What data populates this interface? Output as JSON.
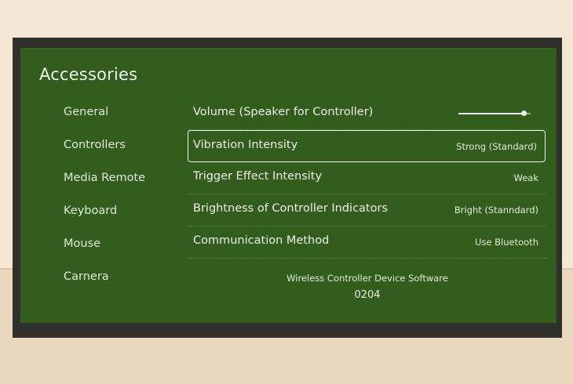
{
  "screen": {
    "title": "Accessories"
  },
  "sidebar": {
    "items": [
      {
        "label": "General"
      },
      {
        "label": "Controllers"
      },
      {
        "label": "Media Remote"
      },
      {
        "label": "Keyboard"
      },
      {
        "label": "Mouse"
      },
      {
        "label": "Carnera"
      }
    ]
  },
  "settings": {
    "rows": [
      {
        "label": "Volume (Speaker for Controller)",
        "value": ""
      },
      {
        "label": "Vibration Intensity",
        "value": "Strong (Standard)"
      },
      {
        "label": "Trigger Effect Intensity",
        "value": "Weak"
      },
      {
        "label": "Brightness of Controller Indicators",
        "value": "Bright (Stanndard)"
      },
      {
        "label": "Communication Method",
        "value": "Use Bluetooth"
      }
    ],
    "volume_level": 0.9,
    "selected_index": 1
  },
  "software": {
    "label": "Wireless Controller Device Software",
    "version": "0204"
  },
  "colors": {
    "screen_background": "#325d1c",
    "tv_bezel": "#2f302c",
    "wall": "#f4e8d4",
    "highlight": "#f4f6f0"
  }
}
